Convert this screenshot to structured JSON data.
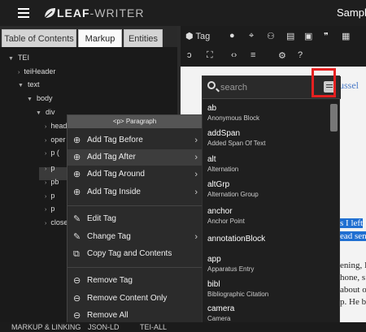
{
  "app": {
    "logo_bold": "LEAF",
    "logo_thin": "-WRITER",
    "doc_title": "Sample"
  },
  "left_tabs": [
    "Table of Contents",
    "Markup",
    "Entities"
  ],
  "tree": [
    {
      "label": "TEI",
      "caret": "▼"
    },
    {
      "label": "teiHeader",
      "caret": "›"
    },
    {
      "label": "text",
      "caret": "▼"
    },
    {
      "label": "body",
      "caret": "▼"
    },
    {
      "label": "div",
      "caret": "▼"
    },
    {
      "label": "head",
      "caret": "›"
    },
    {
      "label": "oper",
      "caret": "›"
    },
    {
      "label": "p (",
      "caret": "›"
    },
    {
      "label": "p",
      "caret": "›"
    },
    {
      "label": "pb",
      "caret": "›"
    },
    {
      "label": "p",
      "caret": "›"
    },
    {
      "label": "p",
      "caret": "›"
    },
    {
      "label": "close",
      "caret": "›"
    }
  ],
  "toolbar": {
    "tag_label": "Tag"
  },
  "context_menu": {
    "header": "<p> Paragraph",
    "items": [
      {
        "label": "Add Tag Before",
        "icon": "⊕",
        "arrow": "›"
      },
      {
        "label": "Add Tag After",
        "icon": "⊕",
        "arrow": "›"
      },
      {
        "label": "Add Tag Around",
        "icon": "⊕",
        "arrow": "›"
      },
      {
        "label": "Add Tag Inside",
        "icon": "⊕",
        "arrow": "›"
      },
      {
        "label": "Edit Tag",
        "icon": "✎",
        "arrow": ""
      },
      {
        "label": "Change Tag",
        "icon": "✎",
        "arrow": "›"
      },
      {
        "label": "Copy Tag and Contents",
        "icon": "⧉",
        "arrow": ""
      },
      {
        "label": "Remove Tag",
        "icon": "⊖",
        "arrow": ""
      },
      {
        "label": "Remove Content Only",
        "icon": "⊖",
        "arrow": ""
      },
      {
        "label": "Remove All",
        "icon": "⊖",
        "arrow": ""
      }
    ]
  },
  "tag_search": {
    "placeholder": "search",
    "options": [
      {
        "name": "ab",
        "desc": "Anonymous Block"
      },
      {
        "name": "addSpan",
        "desc": "Added Span Of Text"
      },
      {
        "name": "alt",
        "desc": "Alternation"
      },
      {
        "name": "altGrp",
        "desc": "Alternation Group"
      },
      {
        "name": "anchor",
        "desc": "Anchor Point"
      },
      {
        "name": "annotationBlock",
        "desc": ""
      },
      {
        "name": "app",
        "desc": "Apparatus Entry"
      },
      {
        "name": "bibl",
        "desc": "Bibliographic Citation"
      },
      {
        "name": "camera",
        "desc": "Camera"
      }
    ]
  },
  "editor_text": [
    "ussel",
    "s I left",
    "ead sent",
    "ening, I",
    "hone, s",
    "about o",
    "p. He b"
  ],
  "status_tabs": [
    "MARKUP & LINKING",
    "JSON-LD",
    "TEI-ALL"
  ]
}
